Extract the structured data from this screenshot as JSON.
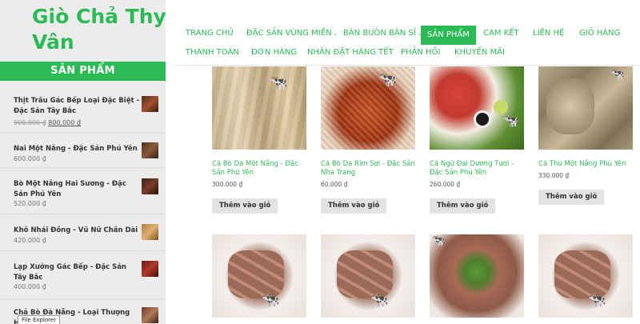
{
  "site": {
    "title": "Giò Chả Thy Vân"
  },
  "nav": {
    "items": [
      {
        "label": "TRANG CHỦ",
        "active": false
      },
      {
        "label": "ĐẶC SẢN VÙNG MIỀN",
        "active": false,
        "dropdown": true
      },
      {
        "label": "BÁN BUÔN BÁN SỈ",
        "active": false,
        "dropdown": true
      },
      {
        "label": "SẢN PHẨM",
        "active": true
      },
      {
        "label": "CAM KẾT",
        "active": false
      },
      {
        "label": "LIÊN HỆ",
        "active": false
      },
      {
        "label": "GIỎ HÀNG",
        "active": false
      },
      {
        "label": "THANH TOÁN",
        "active": false
      },
      {
        "label": "ĐƠN HÀNG",
        "active": false
      },
      {
        "label": "NHÂN ĐẶT HÀNG TẾT",
        "active": false
      },
      {
        "label": "PHẢN HỒI",
        "active": false
      },
      {
        "label": "KHUYẾN MÃI",
        "active": false
      }
    ]
  },
  "sidebar": {
    "title": "SẢN PHẨM",
    "products": [
      {
        "name": "Thịt Trâu Gác Bếp Loại Đặc Biệt - Đặc Sản Tây Bắc",
        "old_price": "900.000 ₫",
        "price": "800.000 ₫"
      },
      {
        "name": "Nai Một Nắng - Đặc Sản Phú Yên",
        "price": "600.000 ₫"
      },
      {
        "name": "Bò Một Nắng Hai Sương - Đặc Sản Phú Yên",
        "price": "520.000 ₫"
      },
      {
        "name": "Khô Nhái Đồng - Vũ Nữ Chân Dài",
        "price": "420.000 ₫"
      },
      {
        "name": "Lạp Xưởng Gác Bếp - Đặc Sản Tây Bắc",
        "price": "400.000 ₫"
      },
      {
        "name": "Chả Bò Đà Nẵng - Loại Thượng Hạng",
        "price": ""
      }
    ]
  },
  "products": [
    {
      "title": "Cá Bò Da Một Nắng - Đặc Sản Phú Yên",
      "price": "300.000 ₫",
      "button": "Thêm vào giỏ"
    },
    {
      "title": "Cá Bò Da Rim Sợi - Đặc Sản Nha Trang",
      "price": "60.000 ₫",
      "button": "Thêm vào giỏ"
    },
    {
      "title": "Cá Ngừ Đại Dương Tươi - Đặc Sản Phú Yên",
      "price": "260.000 ₫",
      "button": "Thêm vào giỏ"
    },
    {
      "title": "Cá Thu Một Nắng Phú Yên",
      "price": "330.000 ₫",
      "button": "Thêm vào giỏ"
    }
  ],
  "tooltip": "File Explorer",
  "colors": {
    "brand": "#2bbb55",
    "sidebar_bg": "#ececec",
    "button_bg": "#e3e3e3"
  }
}
